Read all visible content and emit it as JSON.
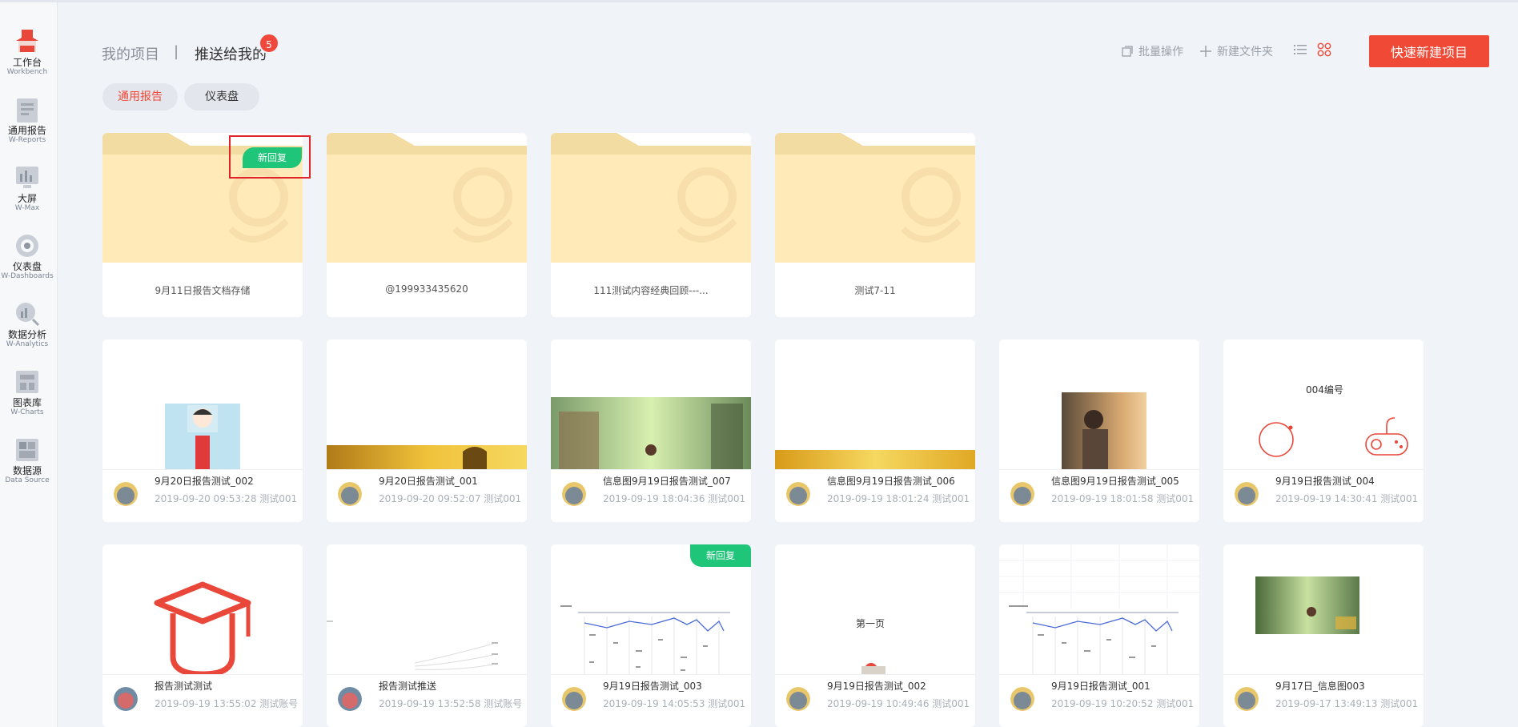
{
  "sidebar": {
    "items": [
      {
        "cn": "工作台",
        "en": "Workbench"
      },
      {
        "cn": "通用报告",
        "en": "W-Reports"
      },
      {
        "cn": "大屏",
        "en": "W-Max"
      },
      {
        "cn": "仪表盘",
        "en": "W-Dashboards"
      },
      {
        "cn": "数据分析",
        "en": "W-Analytics"
      },
      {
        "cn": "图表库",
        "en": "W-Charts"
      },
      {
        "cn": "数据源",
        "en": "Data Source"
      }
    ]
  },
  "header": {
    "tab_mine": "我的项目",
    "tab_sep": "|",
    "tab_pushed": "推送给我的",
    "badge_count": "5",
    "batch": "批量操作",
    "new_folder": "新建文件夹",
    "new_project": "快速新建项目"
  },
  "filters": [
    "通用报告",
    "仪表盘"
  ],
  "reply_label": "新回复",
  "folders": [
    {
      "name": "9月11日报告文档存储"
    },
    {
      "name": "@199933435620"
    },
    {
      "name": "111测试内容经典回顾---..."
    },
    {
      "name": "测试7-11"
    }
  ],
  "reports_row1": [
    {
      "title": "9月20日报告测试_002",
      "meta": "2019-09-20 09:53:28 测试001"
    },
    {
      "title": "9月20日报告测试_001",
      "meta": "2019-09-20 09:52:07 测试001"
    },
    {
      "title": "信息图9月19日报告测试_007",
      "meta": "2019-09-19 18:04:36 测试001"
    },
    {
      "title": "信息图9月19日报告测试_006",
      "meta": "2019-09-19 18:01:24 测试001"
    },
    {
      "title": "信息图9月19日报告测试_005",
      "meta": "2019-09-19 18:01:58 测试001"
    },
    {
      "title": "9月19日报告测试_004",
      "meta": "2019-09-19 14:30:41 测试001",
      "thumb_text": "004编号"
    }
  ],
  "reports_row2": [
    {
      "title": "报告测试测试",
      "meta": "2019-09-19 13:55:02 测试账号"
    },
    {
      "title": "报告测试推送",
      "meta": "2019-09-19 13:52:58 测试账号"
    },
    {
      "title": "9月19日报告测试_003",
      "meta": "2019-09-19 14:05:53 测试001"
    },
    {
      "title": "9月19日报告测试_002",
      "meta": "2019-09-19 10:49:46 测试001",
      "thumb_text": "第一页"
    },
    {
      "title": "9月19日报告测试_001",
      "meta": "2019-09-19 10:20:52 测试001"
    },
    {
      "title": "9月17日_信息图003",
      "meta": "2019-09-17 13:49:13 测试001"
    }
  ],
  "colors": {
    "accent": "#f04a36",
    "reply": "#1fc67a",
    "folder": "#ffeab8",
    "folder_tab": "#f3dca2"
  }
}
